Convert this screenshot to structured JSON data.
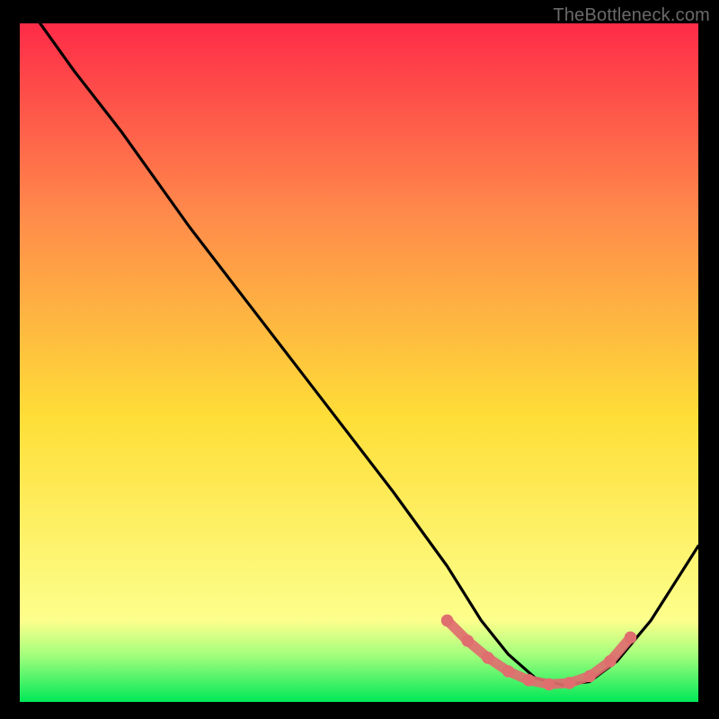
{
  "watermark": "TheBottleneck.com",
  "colors": {
    "frame": "#000000",
    "curve": "#000000",
    "dots": "#df6e6f",
    "gradient_top": "#fe2b48",
    "gradient_mid1": "#ff8a4b",
    "gradient_mid2": "#fede37",
    "gradient_low": "#fdff8c",
    "green_top": "#a5ff7d",
    "green_bottom": "#00e858"
  },
  "chart_data": {
    "type": "line",
    "title": "",
    "xlabel": "",
    "ylabel": "",
    "xlim": [
      0,
      100
    ],
    "ylim": [
      0,
      100
    ],
    "curve": {
      "name": "bottleneck",
      "x": [
        3,
        8,
        15,
        25,
        35,
        45,
        55,
        63,
        68,
        72,
        76,
        80,
        84,
        88,
        93,
        100
      ],
      "y": [
        100,
        93,
        84,
        70,
        57,
        44,
        31,
        20,
        12,
        7,
        3.5,
        2.5,
        3,
        6,
        12,
        23
      ]
    },
    "highlight_band": {
      "name": "optimal-range",
      "x": [
        63,
        66,
        69,
        72,
        75,
        78,
        81,
        84,
        87,
        90
      ],
      "y": [
        12,
        9,
        6.5,
        4.5,
        3.2,
        2.6,
        2.8,
        3.8,
        6.0,
        9.5
      ]
    },
    "gradient_stops": [
      {
        "offset": 0.0,
        "color": "#fe2b48"
      },
      {
        "offset": 0.28,
        "color": "#ff8a4b"
      },
      {
        "offset": 0.58,
        "color": "#fede37"
      },
      {
        "offset": 0.88,
        "color": "#fdff8c"
      },
      {
        "offset": 0.93,
        "color": "#a5ff7d"
      },
      {
        "offset": 1.0,
        "color": "#00e858"
      }
    ]
  }
}
